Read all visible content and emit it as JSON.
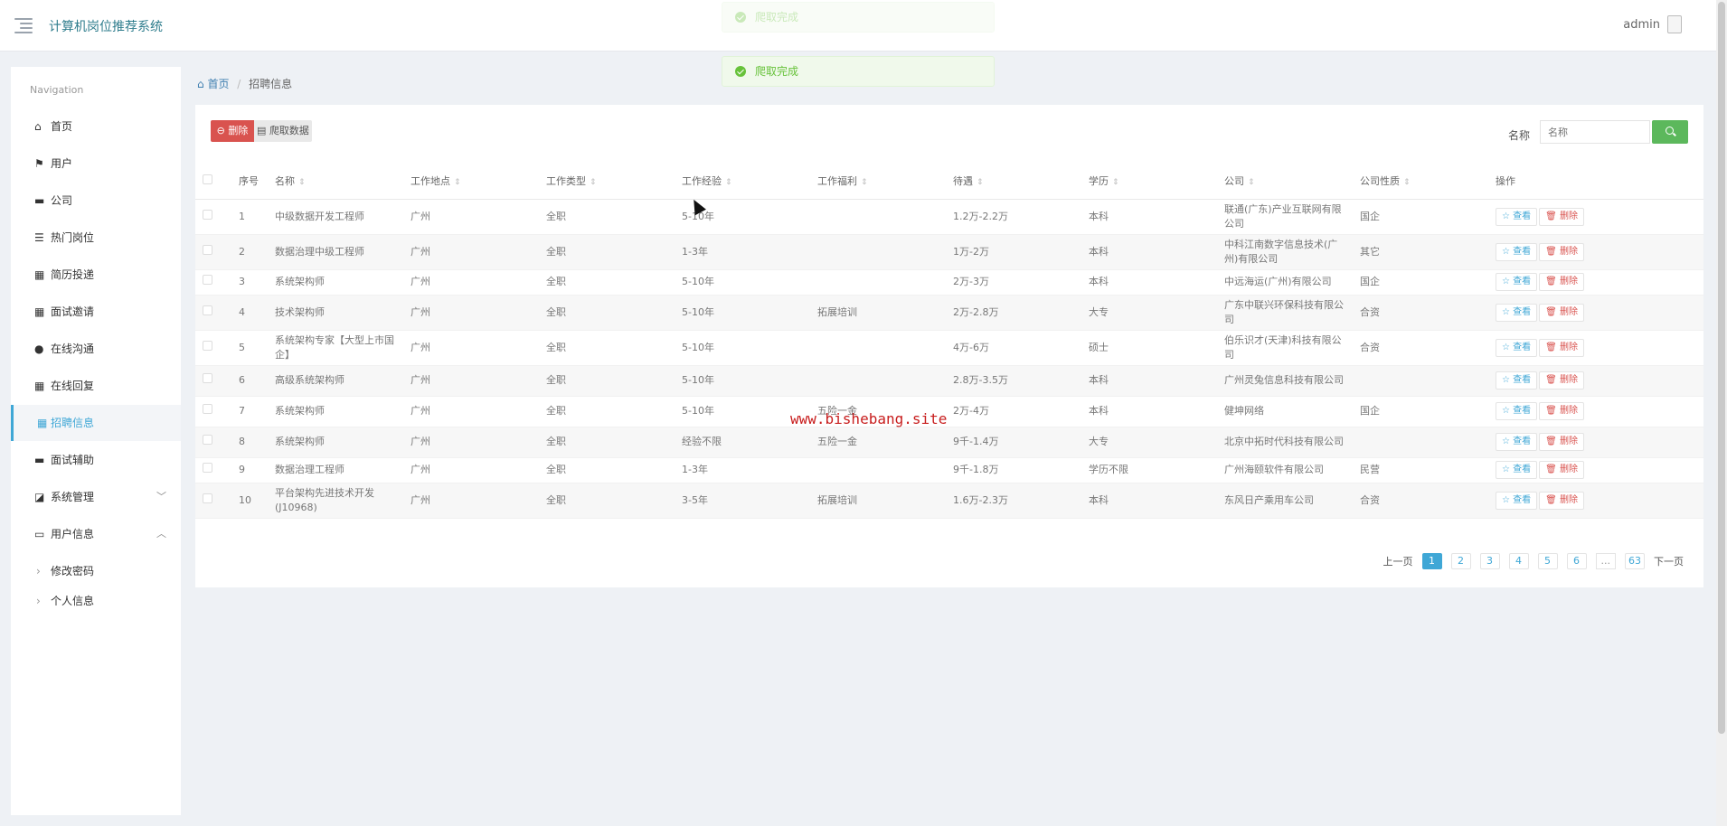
{
  "app": {
    "title": "计算机岗位推荐系统",
    "user": "admin"
  },
  "toasts": [
    {
      "text": "爬取完成"
    },
    {
      "text": "爬取完成"
    }
  ],
  "sidebar": {
    "heading": "Navigation",
    "items": [
      {
        "label": "首页",
        "icon": "home-icon"
      },
      {
        "label": "用户",
        "icon": "flag-icon"
      },
      {
        "label": "公司",
        "icon": "briefcase-icon"
      },
      {
        "label": "热门岗位",
        "icon": "list-icon"
      },
      {
        "label": "简历投递",
        "icon": "grid-icon"
      },
      {
        "label": "面试邀请",
        "icon": "grid-icon"
      },
      {
        "label": "在线沟通",
        "icon": "pin-icon"
      },
      {
        "label": "在线回复",
        "icon": "grid-icon"
      },
      {
        "label": "招聘信息",
        "icon": "grid-icon",
        "active": true
      },
      {
        "label": "面试辅助",
        "icon": "comment-icon"
      },
      {
        "label": "系统管理",
        "icon": "chart-icon",
        "caret": "﹀"
      },
      {
        "label": "用户信息",
        "icon": "card-icon",
        "caret": "︿"
      }
    ],
    "subitems": [
      {
        "label": "修改密码"
      },
      {
        "label": "个人信息"
      }
    ]
  },
  "breadcrumb": {
    "home": "首页",
    "current": "招聘信息"
  },
  "toolbar": {
    "delete_label": "删除",
    "crawl_label": "爬取数据",
    "search_label": "名称",
    "search_placeholder": "名称"
  },
  "table": {
    "columns": [
      "序号",
      "名称",
      "工作地点",
      "工作类型",
      "工作经验",
      "工作福利",
      "待遇",
      "学历",
      "公司",
      "公司性质",
      "操作"
    ],
    "view_label": "查看",
    "delete_label": "删除",
    "rows": [
      {
        "no": "1",
        "name": "中级数据开发工程师",
        "location": "广州",
        "type": "全职",
        "experience": "5-10年",
        "welfare": "",
        "salary": "1.2万-2.2万",
        "education": "本科",
        "company": "联通(广东)产业互联网有限公司",
        "nature": "国企"
      },
      {
        "no": "2",
        "name": "数据治理中级工程师",
        "location": "广州",
        "type": "全职",
        "experience": "1-3年",
        "welfare": "",
        "salary": "1万-2万",
        "education": "本科",
        "company": "中科江南数字信息技术(广州)有限公司",
        "nature": "其它"
      },
      {
        "no": "3",
        "name": "系统架构师",
        "location": "广州",
        "type": "全职",
        "experience": "5-10年",
        "welfare": "",
        "salary": "2万-3万",
        "education": "本科",
        "company": "中远海运(广州)有限公司",
        "nature": "国企"
      },
      {
        "no": "4",
        "name": "技术架构师",
        "location": "广州",
        "type": "全职",
        "experience": "5-10年",
        "welfare": "拓展培训",
        "salary": "2万-2.8万",
        "education": "大专",
        "company": "广东中联兴环保科技有限公司",
        "nature": "合资"
      },
      {
        "no": "5",
        "name": "系统架构专家【大型上市国企】",
        "location": "广州",
        "type": "全职",
        "experience": "5-10年",
        "welfare": "",
        "salary": "4万-6万",
        "education": "硕士",
        "company": "伯乐识才(天津)科技有限公司",
        "nature": "合资"
      },
      {
        "no": "6",
        "name": "高级系统架构师",
        "location": "广州",
        "type": "全职",
        "experience": "5-10年",
        "welfare": "",
        "salary": "2.8万-3.5万",
        "education": "本科",
        "company": "广州灵兔信息科技有限公司",
        "nature": ""
      },
      {
        "no": "7",
        "name": "系统架构师",
        "location": "广州",
        "type": "全职",
        "experience": "5-10年",
        "welfare": "五险一金",
        "salary": "2万-4万",
        "education": "本科",
        "company": "健坤网络",
        "nature": "国企"
      },
      {
        "no": "8",
        "name": "系统架构师",
        "location": "广州",
        "type": "全职",
        "experience": "经验不限",
        "welfare": "五险一金",
        "salary": "9千-1.4万",
        "education": "大专",
        "company": "北京中拓时代科技有限公司",
        "nature": ""
      },
      {
        "no": "9",
        "name": "数据治理工程师",
        "location": "广州",
        "type": "全职",
        "experience": "1-3年",
        "welfare": "",
        "salary": "9千-1.8万",
        "education": "学历不限",
        "company": "广州海颐软件有限公司",
        "nature": "民营"
      },
      {
        "no": "10",
        "name": "平台架构先进技术开发(J10968)",
        "location": "广州",
        "type": "全职",
        "experience": "3-5年",
        "welfare": "拓展培训",
        "salary": "1.6万-2.3万",
        "education": "本科",
        "company": "东风日产乘用车公司",
        "nature": "合资"
      }
    ]
  },
  "pagination": {
    "prev": "上一页",
    "next": "下一页",
    "pages": [
      "1",
      "2",
      "3",
      "4",
      "5",
      "6"
    ],
    "ellipsis": "...",
    "last": "63",
    "current": "1"
  },
  "watermark": "www.bishebang.site",
  "colors": {
    "accent": "#3fa7d6",
    "danger": "#d9534f",
    "success": "#5cb85c",
    "title": "#2f7d8d"
  }
}
